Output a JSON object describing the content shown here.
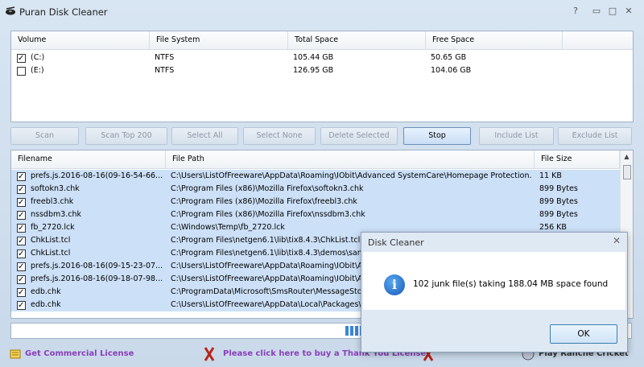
{
  "window": {
    "title": "Puran Disk Cleaner",
    "help": "?",
    "minimize": "▭",
    "maximize": "□",
    "close": "✕"
  },
  "volume_table": {
    "headers": [
      "Volume",
      "File System",
      "Total Space",
      "Free Space"
    ],
    "rows": [
      {
        "checked": true,
        "volume": "(C:)",
        "fs": "NTFS",
        "total": "105.44 GB",
        "free": "50.65 GB"
      },
      {
        "checked": false,
        "volume": "(E:)",
        "fs": "NTFS",
        "total": "126.95 GB",
        "free": "104.06 GB"
      }
    ]
  },
  "buttons": {
    "scan": "Scan",
    "scan_top": "Scan Top 200",
    "select_all": "Select All",
    "select_none": "Select None",
    "delete_selected": "Delete Selected",
    "stop": "Stop",
    "include_list": "Include List",
    "exclude_list": "Exclude List"
  },
  "file_table": {
    "headers": [
      "Filename",
      "File Path",
      "File Size"
    ],
    "rows": [
      {
        "name": "prefs.js.2016-08-16(09-16-54-66...",
        "path": "C:\\Users\\ListOfFreeware\\AppData\\Roaming\\IObit\\Advanced SystemCare\\Homepage Protection...",
        "size": "11 KB"
      },
      {
        "name": "softokn3.chk",
        "path": "C:\\Program Files (x86)\\Mozilla Firefox\\softokn3.chk",
        "size": "899 Bytes"
      },
      {
        "name": "freebl3.chk",
        "path": "C:\\Program Files (x86)\\Mozilla Firefox\\freebl3.chk",
        "size": "899 Bytes"
      },
      {
        "name": "nssdbm3.chk",
        "path": "C:\\Program Files (x86)\\Mozilla Firefox\\nssdbm3.chk",
        "size": "899 Bytes"
      },
      {
        "name": "fb_2720.lck",
        "path": "C:\\Windows\\Temp\\fb_2720.lck",
        "size": "256 KB"
      },
      {
        "name": "ChkList.tcl",
        "path": "C:\\Program Files\\netgen6.1\\lib\\tix8.4.3\\ChkList.tcl",
        "size": ""
      },
      {
        "name": "ChkList.tcl",
        "path": "C:\\Program Files\\netgen6.1\\lib\\tix8.4.3\\demos\\samp",
        "size": ""
      },
      {
        "name": "prefs.js.2016-08-16(09-15-23-07...",
        "path": "C:\\Users\\ListOfFreeware\\AppData\\Roaming\\IObit\\A",
        "size": ""
      },
      {
        "name": "prefs.js.2016-08-16(09-18-07-98...",
        "path": "C:\\Users\\ListOfFreeware\\AppData\\Roaming\\IObit\\A",
        "size": ""
      },
      {
        "name": "edb.chk",
        "path": "C:\\ProgramData\\Microsoft\\SmsRouter\\MessageStore",
        "size": ""
      },
      {
        "name": "edb.chk",
        "path": "C:\\Users\\ListOfFreeware\\AppData\\Local\\Packages\\M",
        "size": ""
      }
    ]
  },
  "footer": {
    "license": "Get Commercial License",
    "thank_you": "Please click here to buy a Thank You License",
    "play": "Play Ranche Cricket"
  },
  "dialog": {
    "title": "Disk Cleaner",
    "close": "✕",
    "message": "102 junk file(s) taking 188.04 MB space found",
    "ok": "OK"
  },
  "colors": {
    "selection": "#cce0f7",
    "accent": "#3a86d6"
  }
}
